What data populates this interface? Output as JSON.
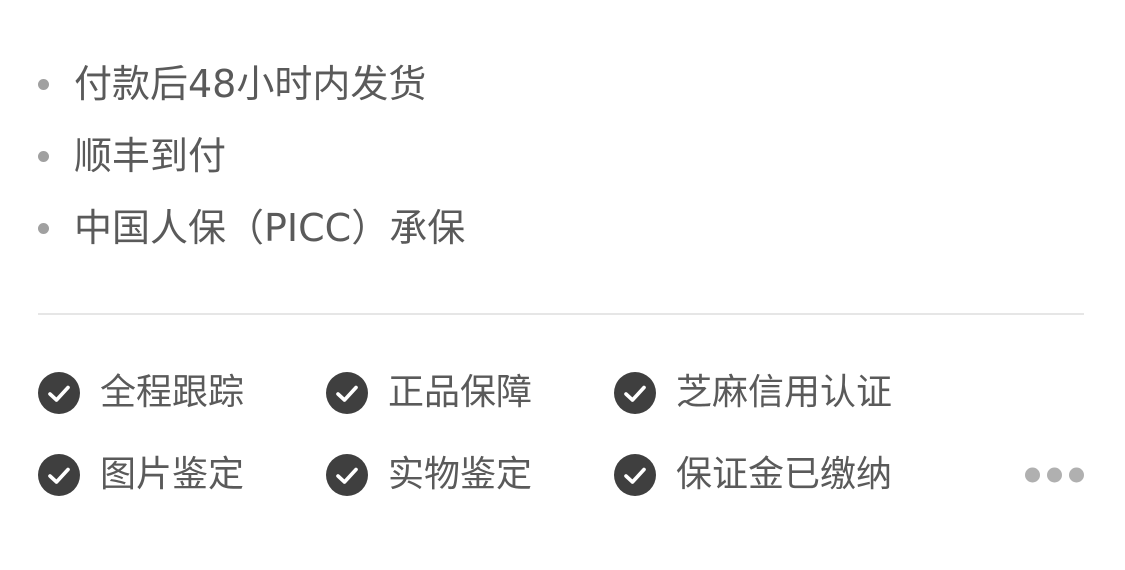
{
  "shipping_info": {
    "items": [
      {
        "text": "付款后48小时内发货"
      },
      {
        "text": "顺丰到付"
      },
      {
        "text": "中国人保（PICC）承保"
      }
    ]
  },
  "guarantees": {
    "row1": [
      {
        "label": "全程跟踪",
        "icon": "check-circle-icon"
      },
      {
        "label": "正品保障",
        "icon": "check-circle-icon"
      },
      {
        "label": "芝麻信用认证",
        "icon": "check-circle-icon"
      }
    ],
    "row2": [
      {
        "label": "图片鉴定",
        "icon": "check-circle-icon"
      },
      {
        "label": "实物鉴定",
        "icon": "check-circle-icon"
      },
      {
        "label": "保证金已缴纳",
        "icon": "check-circle-icon"
      }
    ],
    "more_icon": "more-dots-icon"
  },
  "colors": {
    "text": "#5a5a5a",
    "bullet": "#a0a0a0",
    "check_bg": "#3f3f3f",
    "divider": "#e6e6e6",
    "more_dots": "#b0b0b0"
  }
}
